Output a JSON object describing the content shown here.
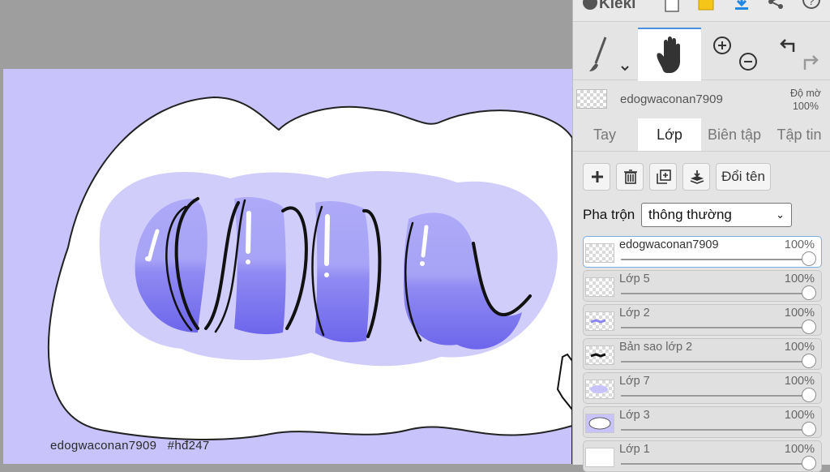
{
  "app": {
    "name": "Kleki"
  },
  "canvas": {
    "caption": "edogwaconan7909   #hđ247"
  },
  "layer_header": {
    "name": "edogwaconan7909",
    "opacity_label": "Độ mờ",
    "opacity_value": "100%"
  },
  "tabs": [
    {
      "label": "Tay"
    },
    {
      "label": "Lớp"
    },
    {
      "label": "Biên tập"
    },
    {
      "label": "Tập tin"
    }
  ],
  "layer_buttons": {
    "rename_label": "Đổi tên"
  },
  "blend": {
    "label": "Pha trộn",
    "value": "thông thường"
  },
  "layers": [
    {
      "name": "edogwaconan7909",
      "opacity": "100%",
      "opacity_value": 1.0
    },
    {
      "name": "Lớp 5",
      "opacity": "100%",
      "opacity_value": 1.0
    },
    {
      "name": "Lớp 2",
      "opacity": "100%",
      "opacity_value": 1.0
    },
    {
      "name": "Bản sao lớp 2",
      "opacity": "100%",
      "opacity_value": 1.0
    },
    {
      "name": "Lớp 7",
      "opacity": "100%",
      "opacity_value": 1.0
    },
    {
      "name": "Lớp 3",
      "opacity": "100%",
      "opacity_value": 1.0
    },
    {
      "name": "Lớp 1",
      "opacity": "100%",
      "opacity_value": 1.0
    }
  ],
  "colors": {
    "accent": "#4a90e2",
    "canvas_bg": "#c8c3fb",
    "lettering": "#8a85f0"
  }
}
